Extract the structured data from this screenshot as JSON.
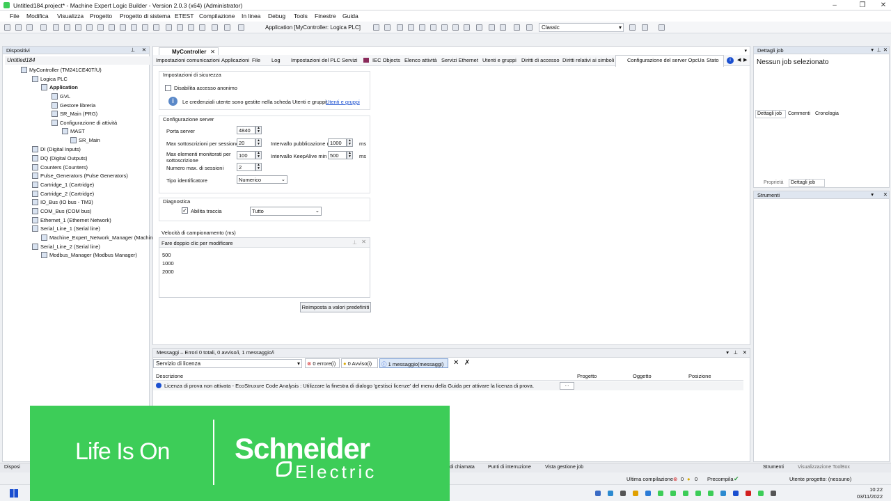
{
  "window": {
    "title": "Untitled184.project* - Machine Expert Logic Builder - Version 2.0.3 (x64) (Administrator)"
  },
  "menu": [
    "File",
    "Modifica",
    "Visualizza",
    "Progetto",
    "Progetto di sistema",
    "ETEST",
    "Compilazione",
    "In linea",
    "Debug",
    "Tools",
    "Finestre",
    "Guida"
  ],
  "toolbar": {
    "application": "Application [MyController: Logica PLC]",
    "layout": "Classic"
  },
  "devices": {
    "title": "Dispositivi",
    "project": "Untitled184",
    "tree": [
      "MyController (TM241CE40T/U)",
      "Logica PLC",
      "Application",
      "GVL",
      "Gestore libreria",
      "SR_Main (PRG)",
      "Configurazione di attività",
      "MAST",
      "SR_Main",
      "DI (Digital Inputs)",
      "DQ (Digital Outputs)",
      "Counters (Counters)",
      "Pulse_Generators (Pulse Generators)",
      "Cartridge_1 (Cartridge)",
      "Cartridge_2 (Cartridge)",
      "IO_Bus (IO bus - TM3)",
      "COM_Bus (COM bus)",
      "Ethernet_1 (Ethernet Network)",
      "Serial_Line_1 (Serial line)",
      "Machine_Expert_Network_Manager (Machine",
      "Serial_Line_2 (Serial line)",
      "Modbus_Manager (Modbus Manager)"
    ]
  },
  "editor": {
    "doc_tab": "MyController",
    "tabs": [
      "Impostazioni comunicazioni",
      "Applicazioni",
      "File",
      "Log",
      "Impostazioni del PLC",
      "Servizi",
      "IEC Objects",
      "Elenco attività",
      "Servizi Ethernet",
      "Utenti e gruppi",
      "Diritti di accesso",
      "Diritti relativi ai simboli",
      "Configurazione del server OpcUa",
      "Stato"
    ]
  },
  "security": {
    "title": "Impostazioni di sicurezza",
    "disable_anon": "Disabilita accesso anonimo",
    "info": "Le credenziali utente sono gestite nella scheda Utenti e gruppi:",
    "link": "Utenti e gruppi"
  },
  "server": {
    "title": "Configurazione server",
    "port_label": "Porta server",
    "port": "4840",
    "max_subs_label": "Max sottoscrizioni per sessione",
    "max_subs": "20",
    "pub_label": "Intervallo pubblicazione m",
    "pub": "1000",
    "ms1": "ms",
    "mon_label1": "Max elementi monitorati per",
    "mon_label2": "sottoscrizione",
    "mon": "100",
    "keep_label": "Intervallo KeepAlive min",
    "keep": "500",
    "ms2": "ms",
    "sess_label": "Numero max. di sessioni",
    "sess": "2",
    "id_label": "Tipo identificatore",
    "id": "Numerico"
  },
  "diag": {
    "title": "Diagnostica",
    "trace": "Abilita traccia",
    "level": "Tutto"
  },
  "sampling": {
    "title": "Velocità di campionamento (ms)",
    "hint": "Fare doppio clic per modificare",
    "rates": [
      "500",
      "1000",
      "2000"
    ]
  },
  "reset_button": "Reimposta a valori predefiniti",
  "messages": {
    "title": "Messaggi – Errori 0 totali, 0 avviso/i, 1 messaggio/i",
    "filter": "Servizio di licenza",
    "errors": "0 errore(i)",
    "warnings": "0 Avviso(i)",
    "infos": "1 messaggio(messaggi)",
    "cols": [
      "Descrizione",
      "Progetto",
      "Oggetto",
      "Posizione"
    ],
    "row": "Licenza di prova non attivata - EcoStruxure Code Analysis : Utilizzare la finestra di dialogo 'gestisci licenze' del menu della Guida per attivare la licenza di prova.",
    "more": "..."
  },
  "jobs": {
    "title": "Dettagli job",
    "none": "Nessun job selezionato",
    "tabs": [
      "Dettagli job",
      "Commenti",
      "Cronologia"
    ],
    "bottom_tabs": [
      "Proprietà",
      "Dettagli job"
    ]
  },
  "tools": {
    "title": "Strumenti"
  },
  "bottom_tabs": [
    "Disposi",
    "di chiamata",
    "Punti di interruzione",
    "Vista gestione job",
    "Strumenti",
    "Visualizzazione ToolBox"
  ],
  "status": {
    "last_build": "Ultima compilazione",
    "e": "0",
    "w": "0",
    "precompile": "Precompila",
    "user": "Utente progetto: (nessuno)"
  },
  "banner": {
    "slogan": "Life Is On",
    "brand": "Schneider",
    "brand2": "Electric"
  },
  "clock": {
    "time": "10:22",
    "date": "03/11/2022"
  },
  "colors": {
    "brand_green": "#3dcd58",
    "link": "#1a4fd0"
  }
}
